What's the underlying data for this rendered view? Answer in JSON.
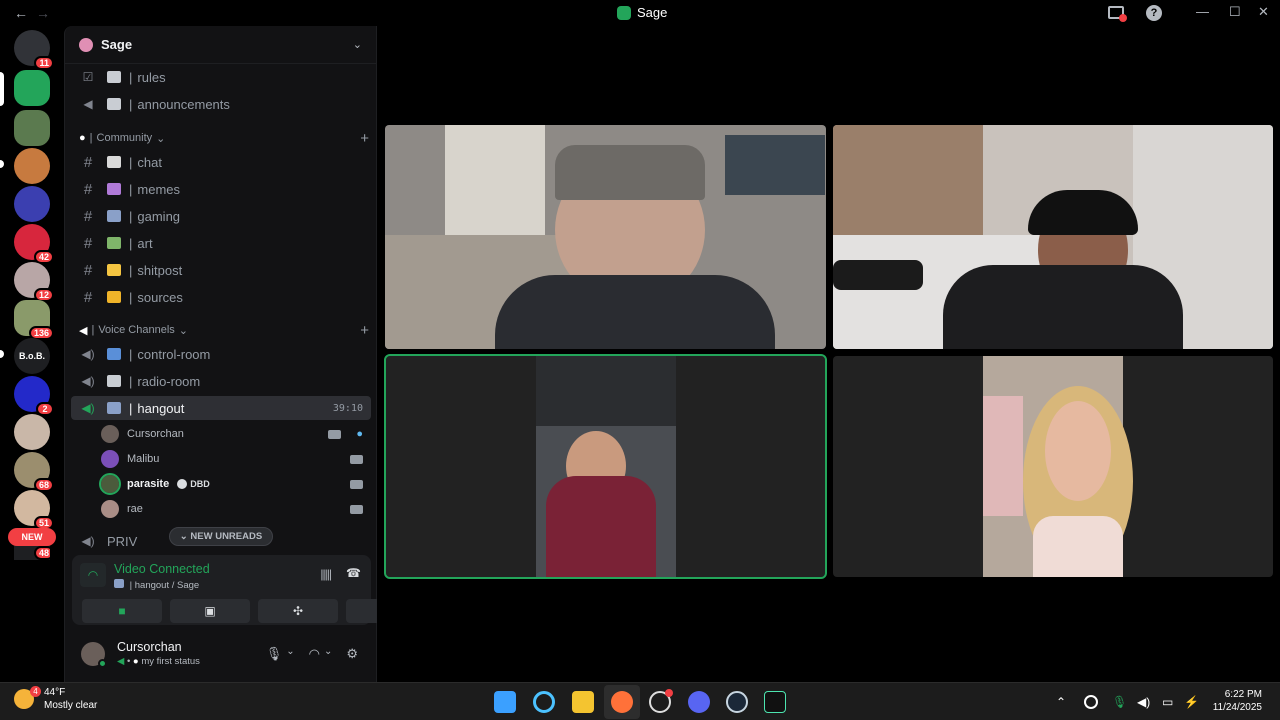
{
  "window": {
    "title": "Sage",
    "back": "←",
    "forward": "→",
    "minimize": "—",
    "maximize": "☐",
    "close": "✕",
    "help": "?"
  },
  "servers": {
    "badges": [
      "11",
      "42",
      "12",
      "136",
      "2",
      "68",
      "51"
    ],
    "bob_label": "B.o.B.",
    "new_pill": "NEW",
    "partial_badge": "48"
  },
  "guild": {
    "name": "Sage",
    "chevron": "⌄"
  },
  "channels_top": [
    {
      "icon": "rules",
      "name": "rules"
    },
    {
      "icon": "announcements",
      "name": "announcements"
    }
  ],
  "categories": {
    "community": {
      "label": "Community",
      "plus": "+"
    },
    "voice": {
      "label": "Voice Channels",
      "plus": "+"
    }
  },
  "text_channels": [
    {
      "name": "chat",
      "color": "#d9d9d9"
    },
    {
      "name": "memes",
      "color": "#b07ad8"
    },
    {
      "name": "gaming",
      "color": "#8aa0c8"
    },
    {
      "name": "art",
      "color": "#7fb56a"
    },
    {
      "name": "shitpost",
      "color": "#f5c542"
    },
    {
      "name": "sources",
      "color": "#f0b429"
    }
  ],
  "voice_channels": [
    {
      "name": "control-room"
    },
    {
      "name": "radio-room"
    },
    {
      "name": "hangout",
      "timer": "39:10"
    }
  ],
  "voice_users": [
    {
      "name": "Cursorchan",
      "color": "#6a5f5a"
    },
    {
      "name": "Malibu",
      "color": "#7b4fb8"
    },
    {
      "name": "parasite",
      "tag": "DBD",
      "color": "#4b5b3c"
    },
    {
      "name": "rae",
      "color": "#a98d86"
    }
  ],
  "priv_channel": "PRIV",
  "new_unreads": "NEW UNREADS",
  "voice_panel": {
    "status": "Video Connected",
    "location": "| hangout / Sage"
  },
  "user": {
    "name": "Cursorchan",
    "status": "my first status"
  },
  "taskbar": {
    "temperature": "44°F",
    "condition": "Mostly clear",
    "weather_badge": "4",
    "time": "6:22 PM",
    "date": "11/24/2025"
  },
  "colors": {
    "accent_green": "#23a55a",
    "badge_red": "#f23f43"
  }
}
